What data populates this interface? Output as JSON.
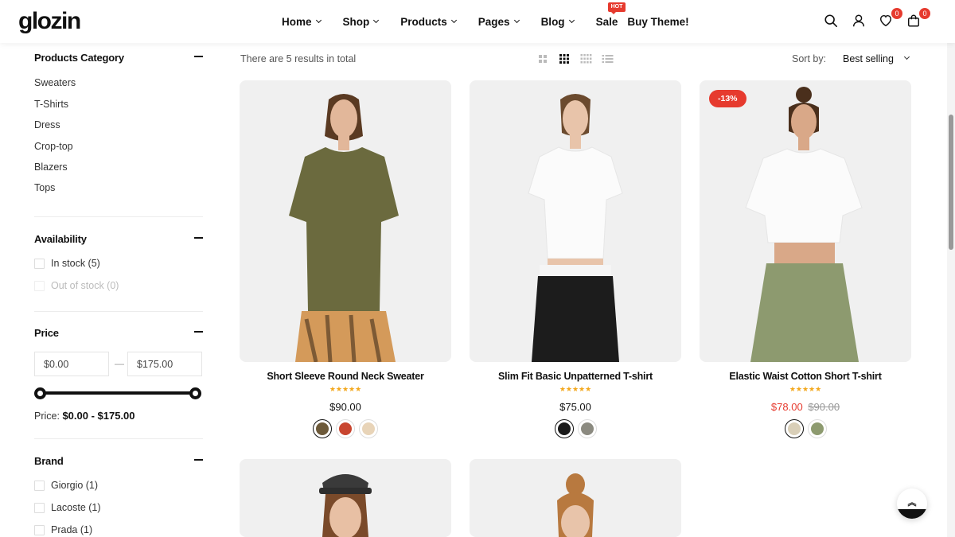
{
  "header": {
    "logo": "glozin",
    "nav": [
      {
        "label": "Home"
      },
      {
        "label": "Shop"
      },
      {
        "label": "Products"
      },
      {
        "label": "Pages"
      },
      {
        "label": "Blog"
      },
      {
        "label": "Sale",
        "badge": "HOT"
      },
      {
        "label": "Buy Theme!"
      }
    ],
    "wishlist_count": "0",
    "cart_count": "0"
  },
  "sidebar": {
    "category": {
      "title": "Products Category",
      "items": [
        "Sweaters",
        "T-Shirts",
        "Dress",
        "Crop-top",
        "Blazers",
        "Tops"
      ]
    },
    "availability": {
      "title": "Availability",
      "options": [
        "In stock (5)",
        "Out of stock (0)"
      ]
    },
    "price": {
      "title": "Price",
      "min_value": "$0.00",
      "max_value": "$175.00",
      "dash": "—",
      "summary_label": "Price:",
      "summary_value": "$0.00 - $175.00",
      "range_min_fraction": 0.0,
      "range_max_fraction": 1.0
    },
    "brand": {
      "title": "Brand",
      "options": [
        "Giorgio (1)",
        "Lacoste (1)",
        "Prada (1)"
      ]
    }
  },
  "toolbar": {
    "results_text": "There are 5 results in total",
    "view_modes": [
      "grid-2-icon",
      "grid-3-icon",
      "grid-4-icon",
      "list-icon"
    ],
    "active_view": "grid-3-icon",
    "sort_label": "Sort by:",
    "sort_value": "Best selling"
  },
  "products": [
    {
      "title": "Short Sleeve Round Neck Sweater",
      "price": "$90.00",
      "stars": "★★★★★",
      "swatch_colors": [
        "#6d5a3a",
        "#c8452f",
        "#e8d4b8"
      ]
    },
    {
      "title": "Slim Fit Basic Unpatterned T-shirt",
      "price": "$75.00",
      "stars": "★★★★★",
      "swatch_colors": [
        "#1a1a1a",
        "#8b8a80"
      ]
    },
    {
      "title": "Elastic Waist Cotton Short T-shirt",
      "badge": "-13%",
      "sale_price": "$78.00",
      "old_price": "$90.00",
      "stars": "★★★★★",
      "swatch_colors": [
        "#d9cfb8",
        "#8d9a6f"
      ]
    }
  ],
  "colors": {
    "accent": "#e63a2e",
    "star": "#f3a71b",
    "card_bg": "#f0f0f0"
  }
}
